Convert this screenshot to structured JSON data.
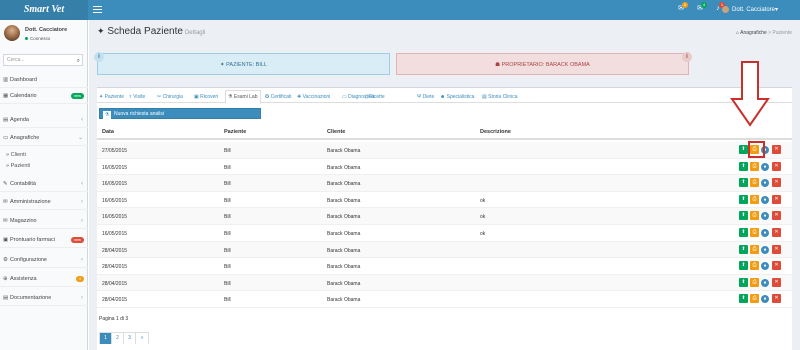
{
  "app": {
    "logo": "Smart Vet"
  },
  "topbar": {
    "user": "Dott. Cacciatore",
    "user_caret": "▾",
    "badges": [
      {
        "icon": "envelope-icon",
        "count": "5",
        "color": "#f39c12"
      },
      {
        "icon": "envelope-icon",
        "count": "4",
        "color": "#00a65a"
      },
      {
        "icon": "bell-icon",
        "count": "1",
        "color": "#dd4b39"
      }
    ]
  },
  "sidebar": {
    "user_name": "Dott. Cacciatore",
    "status": "Connesso",
    "search_placeholder": "Cerca...",
    "items": [
      {
        "label": "Dashboard",
        "icon": "chart-icon",
        "glyph": "▥"
      },
      {
        "label": "Calendario",
        "icon": "calendar-icon",
        "glyph": "▦",
        "pill": "new",
        "pill_color": "#00a65a"
      },
      {
        "label": "Agenda",
        "icon": "book-icon",
        "glyph": "▤",
        "chevron": "‹"
      },
      {
        "label": "Anagrafiche",
        "icon": "folder-icon",
        "glyph": "▭",
        "chevron": "⌄"
      },
      {
        "label": "Contabilità",
        "icon": "edit-icon",
        "glyph": "✎",
        "chevron": "‹"
      },
      {
        "label": "Amministrazione",
        "icon": "envelope-icon",
        "glyph": "✉",
        "chevron": "‹"
      },
      {
        "label": "Magazzino",
        "icon": "envelope-icon",
        "glyph": "✉",
        "chevron": "‹"
      },
      {
        "label": "Prontuario farmaci",
        "icon": "pill-icon",
        "glyph": "▣",
        "pill": "new",
        "pill_color": "#dd4b39"
      },
      {
        "label": "Configurazione",
        "icon": "gear-icon",
        "glyph": "⚙",
        "chevron": "‹"
      },
      {
        "label": "Assistenza",
        "icon": "lifebuoy-icon",
        "glyph": "⊕",
        "pill": "4",
        "pill_color": "#f39c12"
      },
      {
        "label": "Documentazione",
        "icon": "book-icon",
        "glyph": "▤",
        "chevron": "‹"
      }
    ],
    "subitems": [
      "Clienti",
      "Pazienti"
    ]
  },
  "header": {
    "title": "Scheda Paziente",
    "subtitle": "Dettagli",
    "breadcrumb_home": "Anagrafiche",
    "breadcrumb_sep": ">",
    "breadcrumb_current": "Paziente"
  },
  "boxes": {
    "patient": "PAZIENTE: BILL",
    "owner": "PROPRIETARIO: BARACK OBAMA"
  },
  "tabs": [
    {
      "label": "Paziente",
      "icon": "paw-icon",
      "glyph": "✦"
    },
    {
      "label": "Visite",
      "icon": "stethoscope-icon",
      "glyph": "⚕"
    },
    {
      "label": "Chirurgia",
      "icon": "scissors-icon",
      "glyph": "✂"
    },
    {
      "label": "Ricoveri",
      "icon": "hospital-icon",
      "glyph": "▣"
    },
    {
      "label": "Esami Lab",
      "icon": "flask-icon",
      "glyph": "⚗",
      "active": true
    },
    {
      "label": "Certificati",
      "icon": "certificate-icon",
      "glyph": "✪"
    },
    {
      "label": "Vaccinazioni",
      "icon": "syringe-icon",
      "glyph": "✚"
    },
    {
      "label": "Diagnostica",
      "icon": "monitor-icon",
      "glyph": "▭"
    },
    {
      "label": "Ricette",
      "icon": "file-icon",
      "glyph": "▯"
    },
    {
      "label": "Diete",
      "icon": "cutlery-icon",
      "glyph": "Ψ"
    },
    {
      "label": "Specialistica",
      "icon": "user-md-icon",
      "glyph": "☻"
    },
    {
      "label": "Storia Clinica",
      "icon": "history-icon",
      "glyph": "▤"
    }
  ],
  "new_request": "Nuova richiesta analisi",
  "table": {
    "columns": [
      "Data",
      "Paziente",
      "Cliente",
      "Descrizione"
    ],
    "rows": [
      [
        "27/05/2015",
        "Bill",
        "Barack Obama",
        ""
      ],
      [
        "16/05/2015",
        "Bill",
        "Barack Obama",
        ""
      ],
      [
        "16/05/2015",
        "Bill",
        "Barack Obama",
        ""
      ],
      [
        "16/05/2015",
        "Bill",
        "Barack Obama",
        "ok"
      ],
      [
        "16/05/2015",
        "Bill",
        "Barack Obama",
        "ok"
      ],
      [
        "16/05/2015",
        "Bill",
        "Barack Obama",
        "ok"
      ],
      [
        "28/04/2015",
        "Bill",
        "Barack Obama",
        ""
      ],
      [
        "28/04/2015",
        "Bill",
        "Barack Obama",
        ""
      ],
      [
        "28/04/2015",
        "Bill",
        "Barack Obama",
        ""
      ],
      [
        "28/04/2015",
        "Bill",
        "Barack Obama",
        ""
      ]
    ],
    "actions": [
      {
        "name": "upload-icon",
        "glyph": "⬆",
        "style": "g"
      },
      {
        "name": "print-icon",
        "glyph": "⎙",
        "style": "o"
      },
      {
        "name": "view-icon",
        "glyph": "●",
        "style": "b"
      },
      {
        "name": "delete-icon",
        "glyph": "✕",
        "style": "r"
      }
    ]
  },
  "pagination": {
    "info": "Pagina 1 di 3",
    "pages": [
      "1",
      "2",
      "3",
      "»"
    ],
    "current": "1"
  }
}
